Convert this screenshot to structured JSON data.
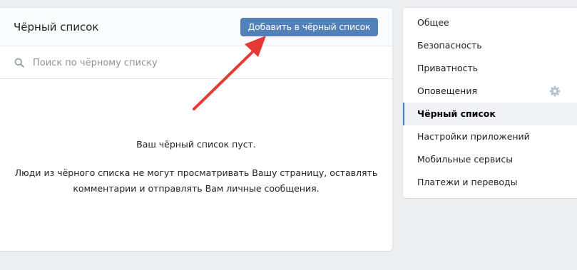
{
  "header": {
    "title": "Чёрный список",
    "add_button_label": "Добавить в чёрный список"
  },
  "search": {
    "placeholder": "Поиск по чёрному списку",
    "value": ""
  },
  "empty_state": {
    "title": "Ваш чёрный список пуст.",
    "description_line1": "Люди из чёрного списка не могут просматривать Вашу страницу, оставлять",
    "description_line2": "комментарии и отправлять Вам личные сообщения."
  },
  "sidebar": {
    "items": [
      {
        "label": "Общее"
      },
      {
        "label": "Безопасность"
      },
      {
        "label": "Приватность"
      },
      {
        "label": "Оповещения",
        "icon": "gear-icon"
      },
      {
        "label": "Чёрный список",
        "active": true
      },
      {
        "label": "Настройки приложений"
      },
      {
        "label": "Мобильные сервисы"
      },
      {
        "label": "Платежи и переводы"
      }
    ]
  },
  "colors": {
    "accent": "#5181b8",
    "annotation_arrow": "#e53935",
    "background": "#edeef0"
  }
}
